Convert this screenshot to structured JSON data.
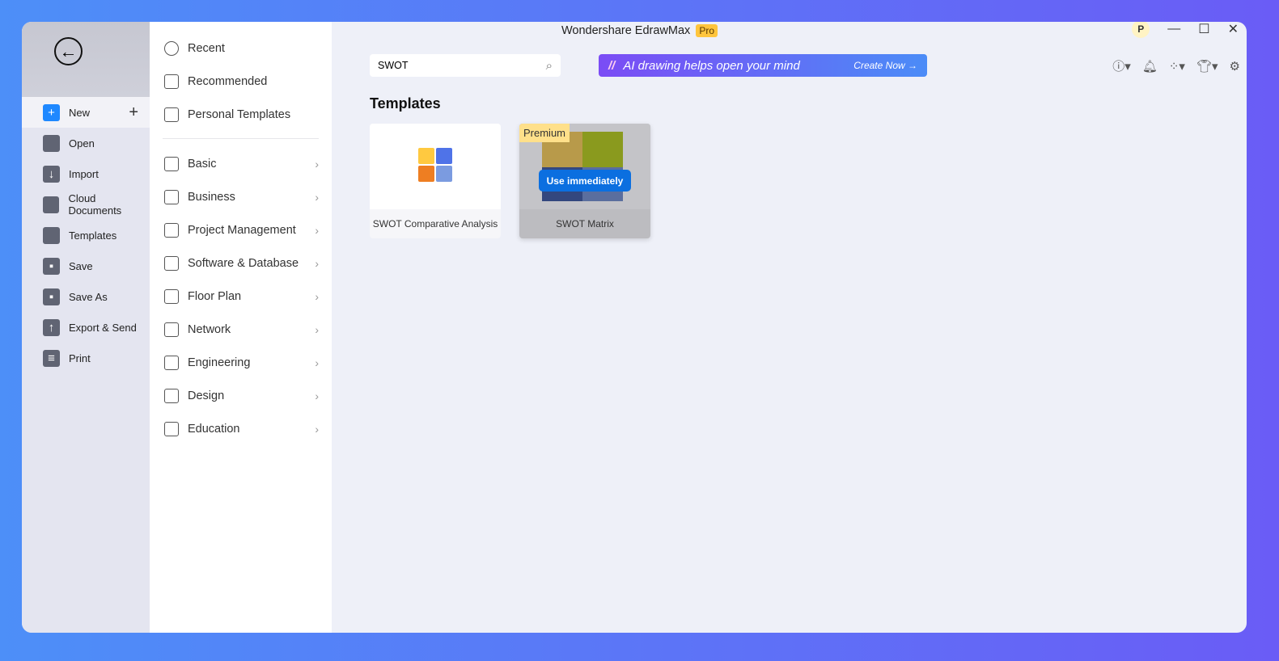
{
  "window": {
    "title": "Wondershare EdrawMax",
    "badge": "Pro",
    "avatar": "P"
  },
  "sidebar": {
    "items": [
      {
        "label": "New",
        "icon": "plus-square-icon",
        "active": true
      },
      {
        "label": "Open",
        "icon": "folder-icon"
      },
      {
        "label": "Import",
        "icon": "import-icon"
      },
      {
        "label": "Cloud Documents",
        "icon": "cloud-icon"
      },
      {
        "label": "Templates",
        "icon": "templates-icon"
      },
      {
        "label": "Save",
        "icon": "save-icon"
      },
      {
        "label": "Save As",
        "icon": "save-as-icon"
      },
      {
        "label": "Export & Send",
        "icon": "export-icon"
      },
      {
        "label": "Print",
        "icon": "print-icon"
      }
    ]
  },
  "categories": {
    "top": [
      {
        "label": "Recent",
        "icon": "clock-icon"
      },
      {
        "label": "Recommended",
        "icon": "star-badge-icon"
      },
      {
        "label": "Personal Templates",
        "icon": "document-icon"
      }
    ],
    "list": [
      {
        "label": "Basic",
        "icon": "tag-icon"
      },
      {
        "label": "Business",
        "icon": "presentation-icon"
      },
      {
        "label": "Project Management",
        "icon": "gantt-icon"
      },
      {
        "label": "Software & Database",
        "icon": "window-icon"
      },
      {
        "label": "Floor Plan",
        "icon": "floor-plan-icon"
      },
      {
        "label": "Network",
        "icon": "calendar-icon"
      },
      {
        "label": "Engineering",
        "icon": "helmet-icon"
      },
      {
        "label": "Design",
        "icon": "design-icon"
      },
      {
        "label": "Education",
        "icon": "graduation-cap-icon"
      }
    ]
  },
  "search": {
    "value": "SWOT"
  },
  "banner": {
    "text": "AI drawing helps open your mind",
    "cta": "Create Now →"
  },
  "main": {
    "heading": "Templates",
    "cards": [
      {
        "title": "SWOT Comparative Analysis"
      },
      {
        "title": "SWOT Matrix",
        "badge": "Premium",
        "action": "Use immediately"
      }
    ]
  },
  "colors": {
    "accent": "#1e88ff",
    "premium": "#ffd666",
    "use_button": "#0b6fe0"
  }
}
